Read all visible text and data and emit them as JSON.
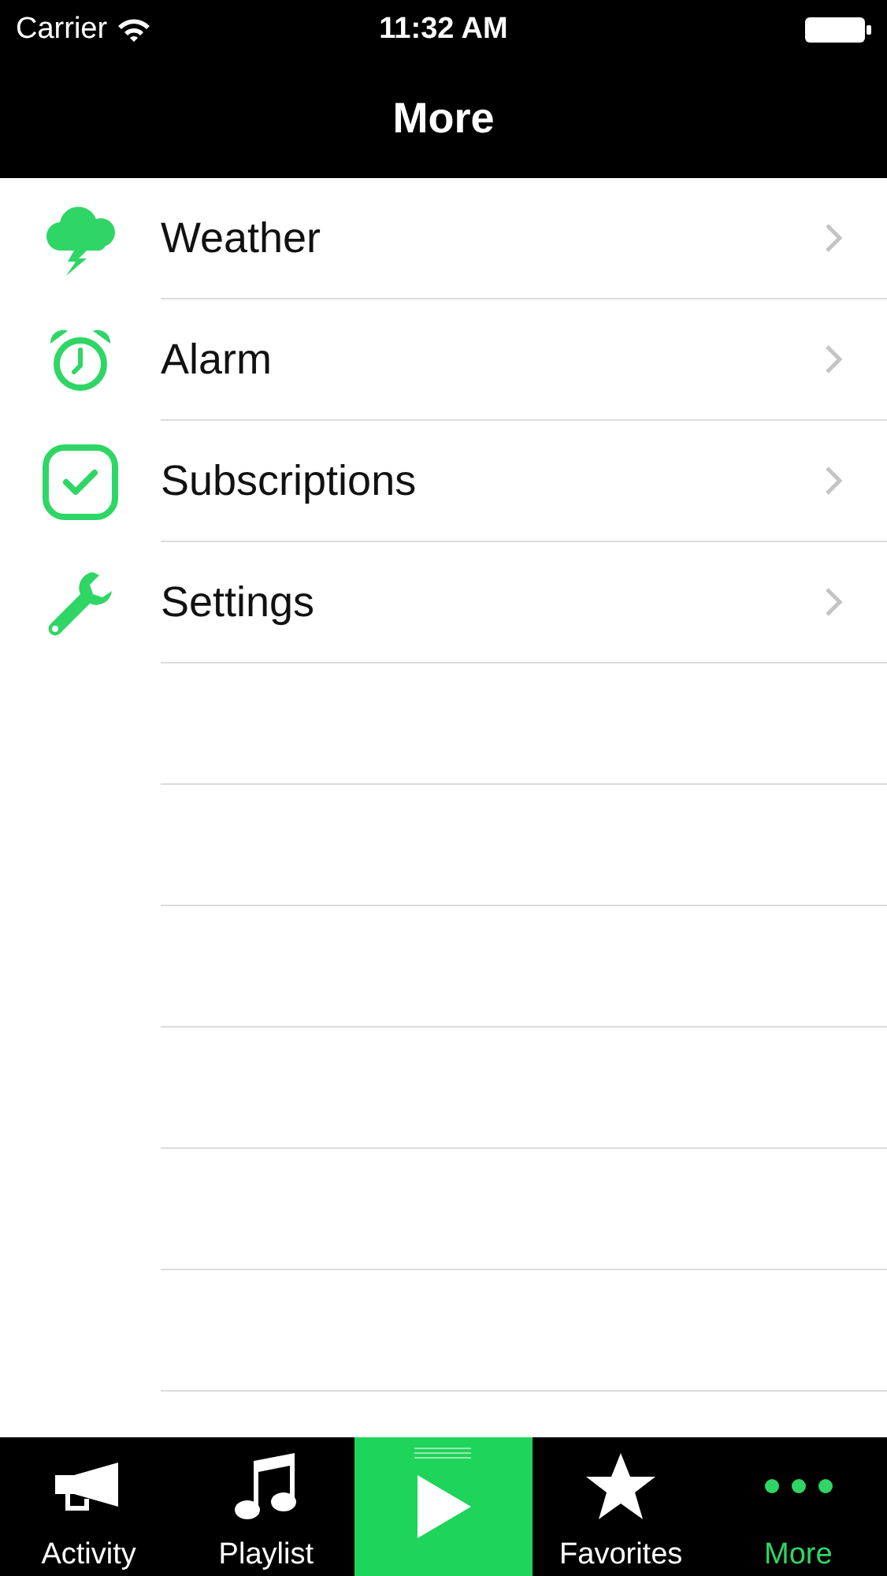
{
  "status_bar": {
    "carrier": "Carrier",
    "time": "11:32 AM"
  },
  "nav_bar": {
    "title": "More"
  },
  "menu_items": [
    {
      "kind": "cloud",
      "label": "Weather"
    },
    {
      "kind": "alarm",
      "label": "Alarm"
    },
    {
      "kind": "check",
      "label": "Subscriptions"
    },
    {
      "kind": "wrench",
      "label": "Settings"
    }
  ],
  "tab_bar": [
    {
      "kind": "megaphone",
      "label": "Activity",
      "selected": false
    },
    {
      "kind": "music",
      "label": "Playlist",
      "selected": false
    },
    {
      "kind": "play",
      "selected": false
    },
    {
      "kind": "star",
      "label": "Favorites",
      "selected": false
    },
    {
      "kind": "dots",
      "label": "More",
      "selected": true
    }
  ]
}
